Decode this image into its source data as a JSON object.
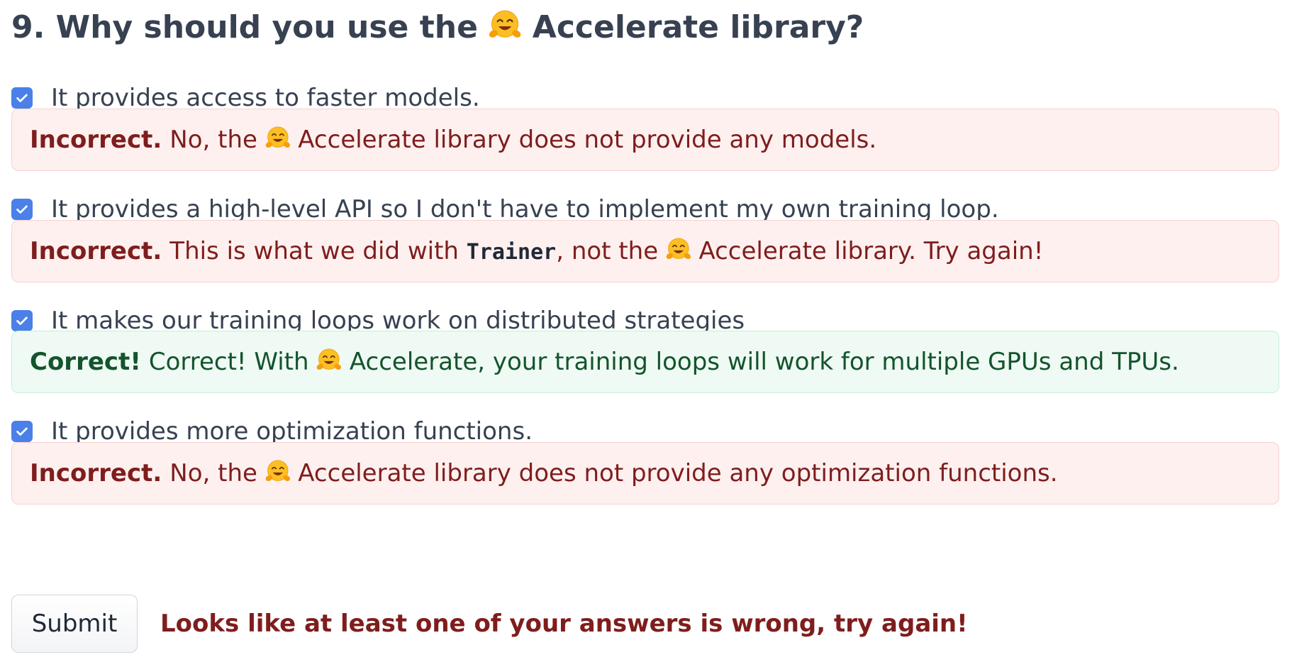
{
  "question": {
    "number": "9.",
    "text_before": "Why should you use the",
    "text_after": "Accelerate library?",
    "emoji_icon": "hugging-face-icon"
  },
  "options": [
    {
      "label": "It provides access to faster models.",
      "checked": true,
      "feedback": {
        "status": "incorrect",
        "verdict": "Incorrect.",
        "text_before": "No, the",
        "text_after": "Accelerate library does not provide any models."
      }
    },
    {
      "label": "It provides a high-level API so I don't have to implement my own training loop.",
      "checked": true,
      "feedback": {
        "status": "incorrect",
        "verdict": "Incorrect.",
        "text_before": "This is what we did with",
        "code": "Trainer",
        "text_middle": ", not the",
        "text_after": "Accelerate library. Try again!"
      }
    },
    {
      "label": "It makes our training loops work on distributed strategies",
      "checked": true,
      "feedback": {
        "status": "correct",
        "verdict": "Correct!",
        "text_before": "Correct! With",
        "text_after": "Accelerate, your training loops will work for multiple GPUs and TPUs."
      }
    },
    {
      "label": "It provides more optimization functions.",
      "checked": true,
      "feedback": {
        "status": "incorrect",
        "verdict": "Incorrect.",
        "text_before": "No, the",
        "text_after": "Accelerate library does not provide any optimization functions."
      }
    }
  ],
  "submit": {
    "label": "Submit"
  },
  "result_message": "Looks like at least one of your answers is wrong, try again!",
  "colors": {
    "checkbox": "#4a80e8",
    "incorrect_bg": "#fdf0ef",
    "incorrect_text": "#7f1d1d",
    "correct_bg": "#eefaf3",
    "correct_text": "#14532d"
  }
}
